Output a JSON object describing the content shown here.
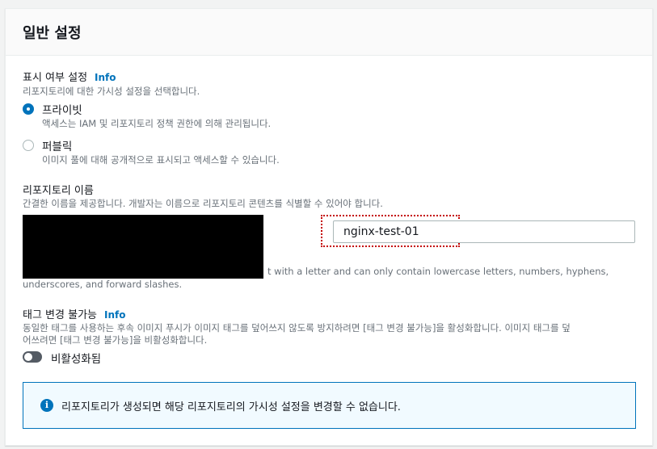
{
  "panel": {
    "title": "일반 설정"
  },
  "visibility": {
    "label": "표시 여부 설정",
    "info": "Info",
    "description": "리포지토리에 대한 가시성 설정을 선택합니다.",
    "options": [
      {
        "label": "프라이빗",
        "description": "액세스는 IAM 및 리포지토리 정책 권한에 의해 관리됩니다.",
        "selected": true
      },
      {
        "label": "퍼블릭",
        "description": "이미지 풀에 대해 공개적으로 표시되고 액세스할 수 있습니다.",
        "selected": false
      }
    ]
  },
  "repo_name": {
    "label": "리포지토리 이름",
    "description": "간결한 이름을 제공합니다. 개발자는 이름으로 리포지토리 콘텐츠를 식별할 수 있어야 합니다.",
    "value": "nginx-test-01",
    "helper_line1": "t with a letter and can only contain lowercase letters, numbers, hyphens,",
    "helper_line2": "underscores, and forward slashes."
  },
  "immutability": {
    "label": "태그 변경 불가능",
    "info": "Info",
    "description_line1": "동일한 태그를 사용하는 후속 이미지 푸시가 이미지 태그를 덮어쓰지 않도록 방지하려면 [태그 변경 불가능]을 활성화합니다. 이미지 태그를 덮",
    "description_line2": "어쓰려면 [태그 변경 불가능]을 비활성화합니다.",
    "toggle_label": "비활성화됨",
    "enabled": false
  },
  "alert": {
    "icon": "info-icon",
    "text": "리포지토리가 생성되면 해당 리포지토리의 가시성 설정을 변경할 수 없습니다."
  },
  "colors": {
    "accent": "#0073bb",
    "highlight": "#c40000"
  }
}
